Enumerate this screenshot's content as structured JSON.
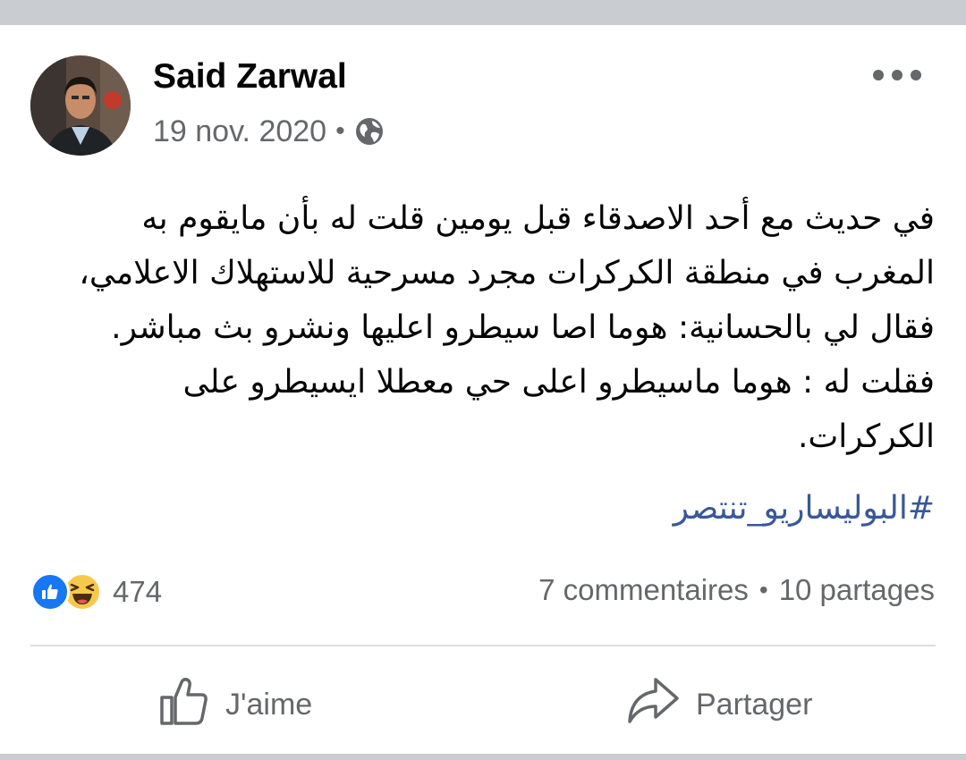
{
  "post": {
    "author": "Said Zarwal",
    "date": "19 nov. 2020",
    "separator": "•",
    "privacy_icon": "globe-icon",
    "lines": [
      "في حديث مع أحد الاصدقاء قبل يومين قلت له بأن مايقوم به",
      "المغرب في منطقة الكركرات مجرد مسرحية للاستهلاك الاعلامي،",
      "فقال لي بالحسانية: هوما اصا سيطرو اعليها ونشرو بث مباشر.",
      "فقلت له : هوما ماسيطرو اعلى حي معطلا ايسيطرو على",
      "الكركرات."
    ],
    "hashtag": "#البوليساريو_تنتصر"
  },
  "stats": {
    "reaction_icons": [
      "like-icon",
      "haha-icon"
    ],
    "reaction_count": "474",
    "comments": "7 commentaires",
    "separator": "•",
    "shares": "10 partages"
  },
  "actions": {
    "like_label": "J'aime",
    "share_label": "Partager"
  },
  "colors": {
    "link": "#385898",
    "like_blue": "#1877f2",
    "secondary_text": "#65676b",
    "frame_gray": "#c9ccd1"
  }
}
